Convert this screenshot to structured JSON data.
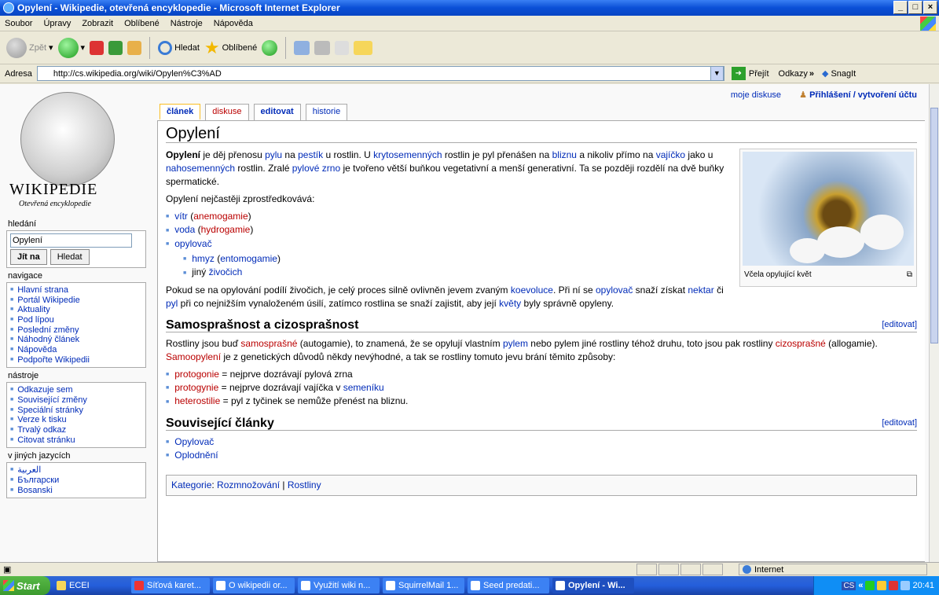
{
  "window": {
    "title": "Opylení - Wikipedie, otevřená encyklopedie - Microsoft Internet Explorer"
  },
  "menu": [
    "Soubor",
    "Úpravy",
    "Zobrazit",
    "Oblíbené",
    "Nástroje",
    "Nápověda"
  ],
  "toolbar": {
    "back": "Zpět",
    "search": "Hledat",
    "favorites": "Oblíbené"
  },
  "address": {
    "label": "Adresa",
    "url": "http://cs.wikipedia.org/wiki/Opylen%C3%AD",
    "go": "Přejít",
    "links": "Odkazy",
    "snagit": "SnagIt"
  },
  "logo": {
    "name": "Wikipedie",
    "tagline": "Otevřená encyklopedie"
  },
  "search": {
    "heading": "hledání",
    "value": "Opylení",
    "go": "Jít na",
    "find": "Hledat"
  },
  "nav": {
    "heading": "navigace",
    "items": [
      "Hlavní strana",
      "Portál Wikipedie",
      "Aktuality",
      "Pod lípou",
      "Poslední změny",
      "Náhodný článek",
      "Nápověda",
      "Podpořte Wikipedii"
    ]
  },
  "tools": {
    "heading": "nástroje",
    "items": [
      "Odkazuje sem",
      "Související změny",
      "Speciální stránky",
      "Verze k tisku",
      "Trvalý odkaz",
      "Citovat stránku"
    ]
  },
  "langs": {
    "heading": "v jiných jazycích",
    "items": [
      "العربية",
      "Български",
      "Bosanski"
    ]
  },
  "personal": {
    "talk": "moje diskuse",
    "login": "Přihlášení / vytvoření účtu"
  },
  "tabs": {
    "article": "článek",
    "discussion": "diskuse",
    "edit": "editovat",
    "history": "historie"
  },
  "article": {
    "title": "Opylení",
    "p1": {
      "b": "Opylení",
      "t1": " je děj přenosu ",
      "l1": "pylu",
      "t2": " na ",
      "l2": "pestík",
      "t3": " u rostlin. U ",
      "l3": "krytosemenných",
      "t4": " rostlin je pyl přenášen na ",
      "l4": "bliznu",
      "t5": " a nikoliv přímo na ",
      "l5": "vajíčko",
      "t6": " jako u ",
      "l6": "nahosemenných",
      "t7": " rostlin. Zralé ",
      "l7": "pylové zrno",
      "t8": " je tvořeno větší buňkou vegetativní a menší generativní. Ta se později rozdělí na dvě buňky spermatické."
    },
    "p2": "Opylení nejčastěji zprostředkovává:",
    "agents": {
      "wind": "vítr",
      "wind_t": "anemogamie",
      "water": "voda",
      "water_t": "hydrogamie",
      "pollinator": "opylovač",
      "insect": "hmyz",
      "insect_t": "entomogamie",
      "other_pre": "jiný ",
      "other": "živočich"
    },
    "p3": {
      "t1": "Pokud se na opylování podílí živočich, je celý proces silně ovlivněn jevem zvaným ",
      "l1": "koevoluce",
      "t2": ". Při ní se ",
      "l2": "opylovač",
      "t3": " snaží získat ",
      "l3": "nektar",
      "t4": " či ",
      "l4": "pyl",
      "t5": " při co nejnižším vynaloženém úsilí, zatímco rostlina se snaží zajistit, aby její ",
      "l5": "květy",
      "t6": " byly správně opyleny."
    },
    "caption": "Včela opylující květ",
    "h2a": "Samosprašnost a cizosprašnost",
    "edit_link": "[editovat]",
    "p4": {
      "t1": "Rostliny jsou buď ",
      "n1": "samosprašné",
      "t2": " (autogamie), to znamená, že se opylují vlastním ",
      "l1": "pylem",
      "t3": " nebo pylem jiné rostliny téhož druhu, toto jsou pak rostliny ",
      "n2": "cizosprašné",
      "t4": " (allogamie). ",
      "n3": "Samoopylení",
      "t5": " je z genetických důvodů někdy nevýhodné, a tak se rostliny tomuto jevu brání těmito způsoby:"
    },
    "methods": {
      "m1": "protogonie",
      "m1t": " = nejprve dozrávají pylová zrna",
      "m2": "protogynie",
      "m2t": " = nejprve dozrávají vajíčka v ",
      "m2l": "semeníku",
      "m3": "heterostilie",
      "m3t": " = pyl z tyčinek se nemůže přenést na bliznu."
    },
    "h2b": "Související články",
    "related": [
      "Opylovač",
      "Oplodnění"
    ],
    "categories": {
      "label": "Kategorie",
      "sep": ": ",
      "c1": "Rozmnožování",
      "bar": " | ",
      "c2": "Rostliny"
    }
  },
  "status": {
    "zone": "Internet"
  },
  "taskbar": {
    "start": "Start",
    "items": [
      "ECEI",
      "Síťová karet...",
      "O wikipedii or...",
      "Využití wiki n...",
      "SquirrelMail 1...",
      "Seed predati...",
      "Opylení - Wi..."
    ],
    "lang": "CS",
    "time": "20:41"
  },
  "colors": {
    "link": "#002bb8",
    "newlink": "#ba0000",
    "xp_blue": "#245edb"
  }
}
